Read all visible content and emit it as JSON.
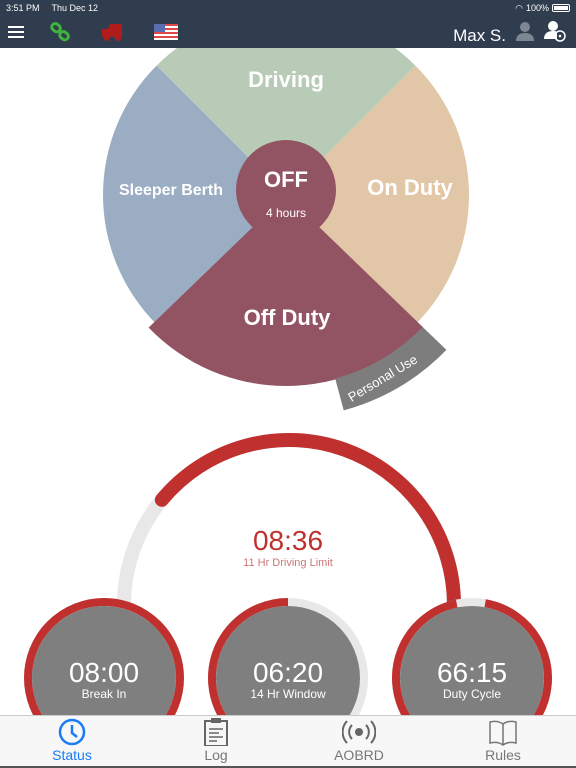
{
  "status_bar": {
    "time": "3:51 PM",
    "date": "Thu Dec 12",
    "battery": "100%"
  },
  "nav": {
    "user_name": "Max S.",
    "icons": [
      "menu-icon",
      "link-icon",
      "truck-icon",
      "us-flag-icon",
      "user-icon",
      "driver-user-icon"
    ],
    "link_color": "#3db53d",
    "truck_color": "#b01c1c"
  },
  "duty_wheel": {
    "center_label": "OFF",
    "center_sub": "4 hours",
    "segments": [
      {
        "label": "Driving",
        "color": "#b8cbb7"
      },
      {
        "label": "On Duty",
        "color": "#e2c6a8"
      },
      {
        "label": "Off Duty",
        "color": "#925463"
      },
      {
        "label": "Sleeper Berth",
        "color": "#9badc2"
      }
    ],
    "personal_use": {
      "label": "Personal Use",
      "color": "#7d7d7d"
    },
    "selected": "Off Duty"
  },
  "gauges": {
    "main": {
      "value": "08:36",
      "label": "11 Hr Driving Limit",
      "fraction": 0.78
    },
    "small": [
      {
        "value": "08:00",
        "label": "Break In",
        "fraction": 1.0
      },
      {
        "value": "06:20",
        "label": "14 Hr Window",
        "fraction": 0.55
      },
      {
        "value": "66:15",
        "label": "Duty Cycle",
        "fraction": 0.94
      }
    ],
    "accent": "#c0302f",
    "track": "#e8e8e8",
    "fill": "#7f7f7f"
  },
  "tabs": [
    {
      "label": "Status",
      "icon": "clock-icon",
      "active": true
    },
    {
      "label": "Log",
      "icon": "clipboard-icon"
    },
    {
      "label": "AOBRD",
      "icon": "broadcast-icon"
    },
    {
      "label": "Rules",
      "icon": "book-icon"
    }
  ]
}
